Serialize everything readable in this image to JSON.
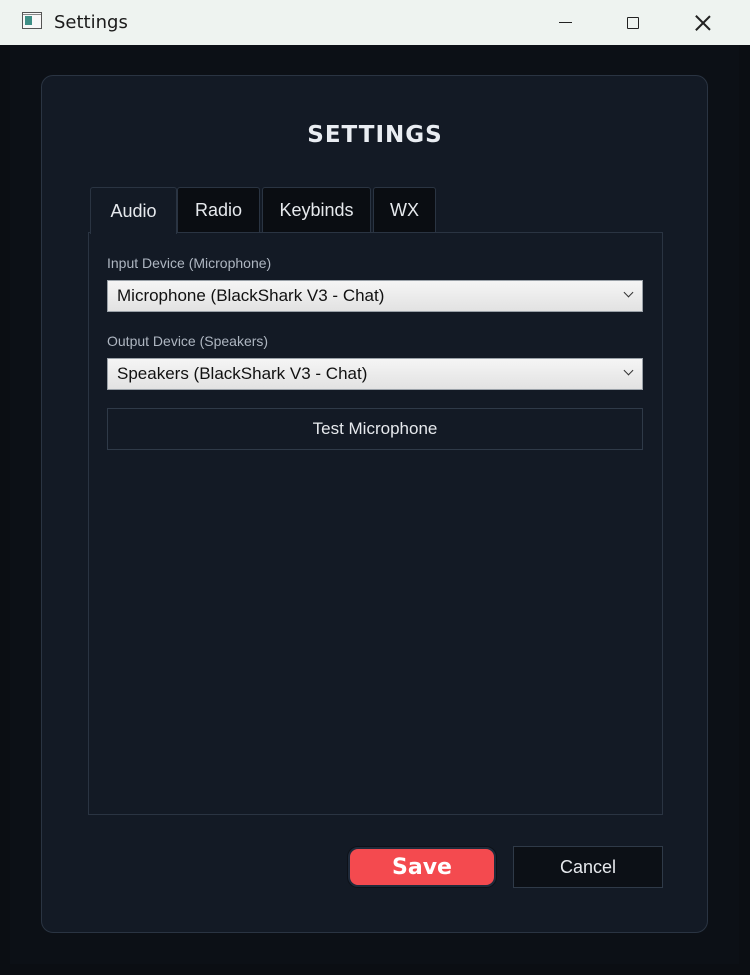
{
  "window": {
    "title": "Settings",
    "icon": "app-window-icon",
    "controls": [
      "minimize-icon",
      "maximize-icon",
      "close-icon"
    ]
  },
  "heading": "SETTINGS",
  "tabs": [
    {
      "label": "Audio",
      "active": true
    },
    {
      "label": "Radio",
      "active": false
    },
    {
      "label": "Keybinds",
      "active": false
    },
    {
      "label": "WX",
      "active": false
    }
  ],
  "audio": {
    "input_label": "Input Device (Microphone)",
    "input_value": "Microphone (BlackShark V3 - Chat)",
    "output_label": "Output Device (Speakers)",
    "output_value": "Speakers (BlackShark V3 - Chat)",
    "test_button": "Test Microphone"
  },
  "footer": {
    "save_label": "Save",
    "cancel_label": "Cancel"
  },
  "colors": {
    "save_accent": "#f44a4f",
    "background": "#0c1016",
    "card": "#131a25"
  }
}
